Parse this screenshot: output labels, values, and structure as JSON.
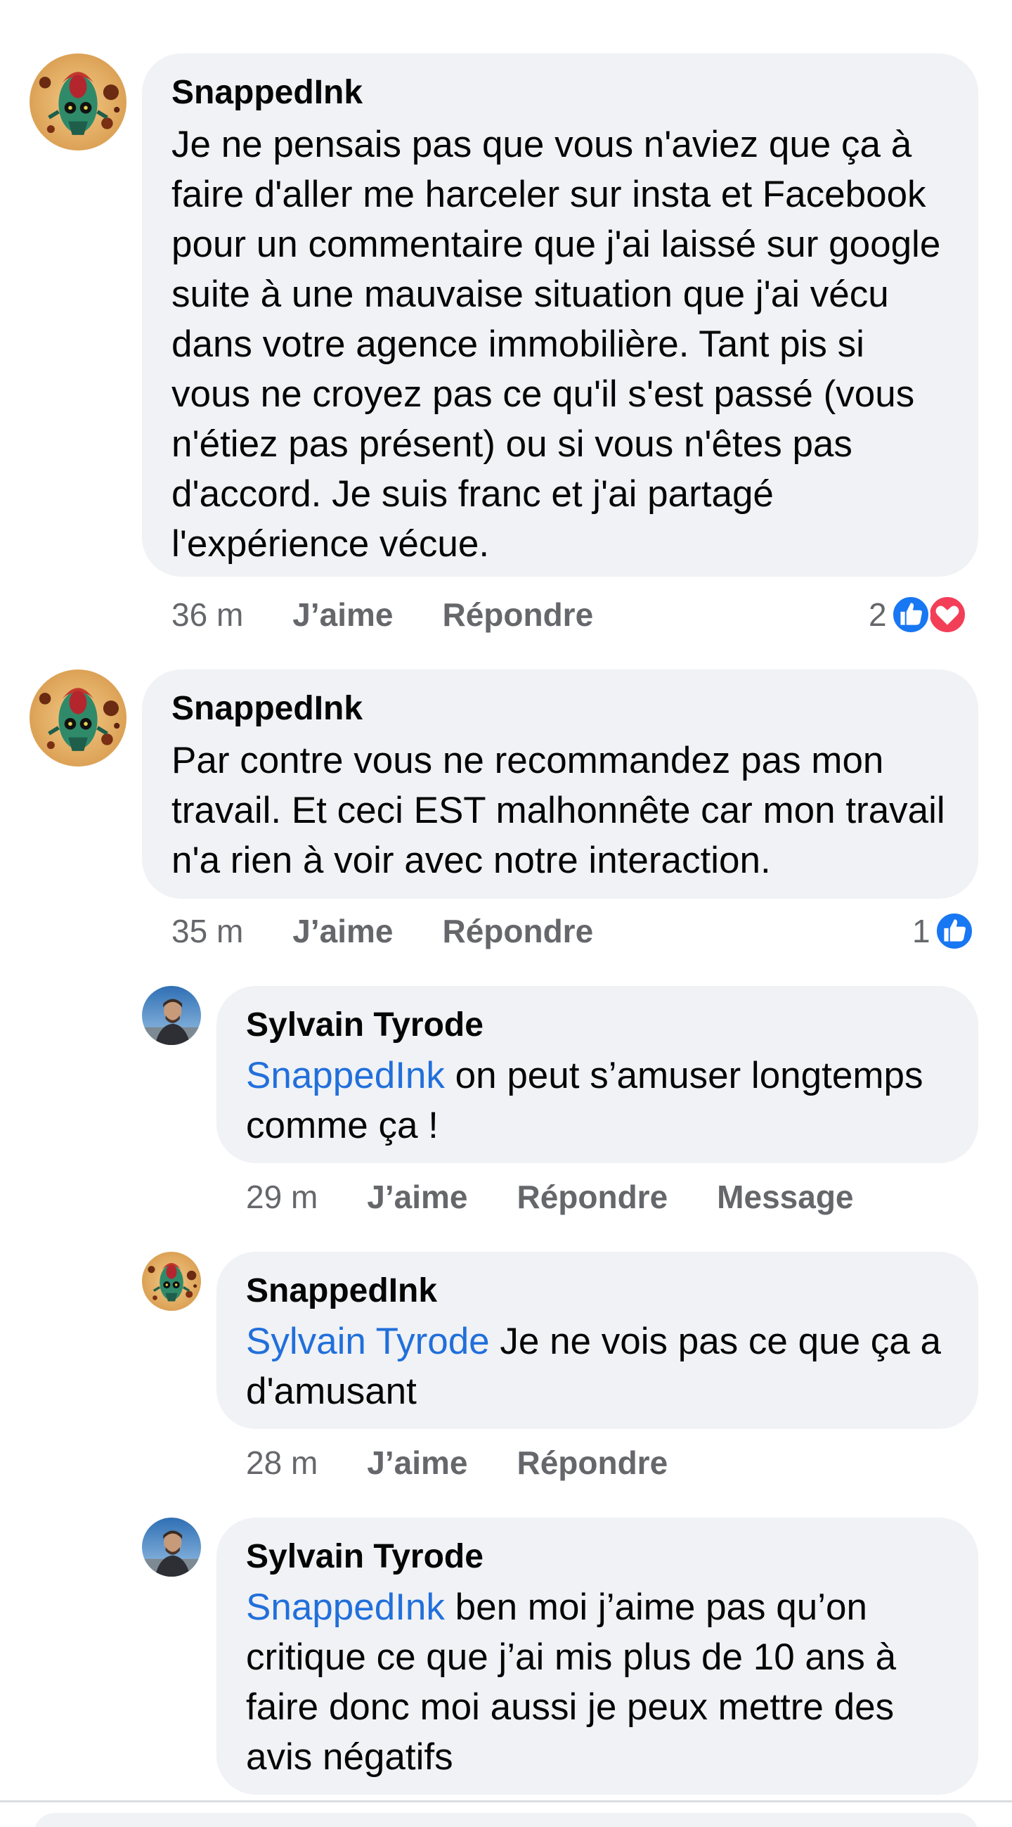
{
  "comments": [
    {
      "author": "SnappedInk",
      "avatar": "skull-tattoo-avatar",
      "text": "Je ne pensais pas que vous n'aviez que ça à faire d'aller me harceler sur insta et Facebook pour un commentaire que j'ai laissé sur google suite à une mauvaise situation que j'ai vécu dans votre agence immobilière. Tant pis si vous ne croyez pas ce qu'il s'est passé (vous n'étiez pas présent) ou si vous n'êtes pas d'accord. Je suis franc et j'ai partagé l'expérience vécue.",
      "time": "36 m",
      "like": "J’aime",
      "reply": "Répondre",
      "reaction_count": "2",
      "reactions": [
        "like-icon",
        "love-icon"
      ]
    },
    {
      "author": "SnappedInk",
      "avatar": "skull-tattoo-avatar",
      "text": "Par contre vous ne recommandez pas mon travail. Et ceci EST malhonnête car mon travail n'a rien à voir avec notre interaction.",
      "time": "35 m",
      "like": "J’aime",
      "reply": "Répondre",
      "reaction_count": "1",
      "reactions": [
        "like-icon"
      ]
    }
  ],
  "replies": [
    {
      "author": "Sylvain Tyrode",
      "avatar": "man-portrait-avatar",
      "mention": "SnappedInk",
      "text": " on peut s’amuser longtemps comme ça !",
      "time": "29 m",
      "like": "J’aime",
      "reply": "Répondre",
      "message": "Message"
    },
    {
      "author": "SnappedInk",
      "avatar": "skull-tattoo-avatar",
      "mention": "Sylvain Tyrode",
      "text": " Je ne vois pas ce que ça a d'amusant",
      "time": "28 m",
      "like": "J’aime",
      "reply": "Répondre"
    },
    {
      "author": "Sylvain Tyrode",
      "avatar": "man-portrait-avatar",
      "mention": "SnappedInk",
      "text": " ben moi j’aime pas qu’on critique ce que j’ai mis plus de 10 ans à faire donc moi aussi je peux mettre des avis négatifs"
    }
  ],
  "colors": {
    "bubble": "#f0f2f5",
    "mention": "#216fdb",
    "meta": "#65676b",
    "like": "#1877f2",
    "love": "#f33e58"
  }
}
